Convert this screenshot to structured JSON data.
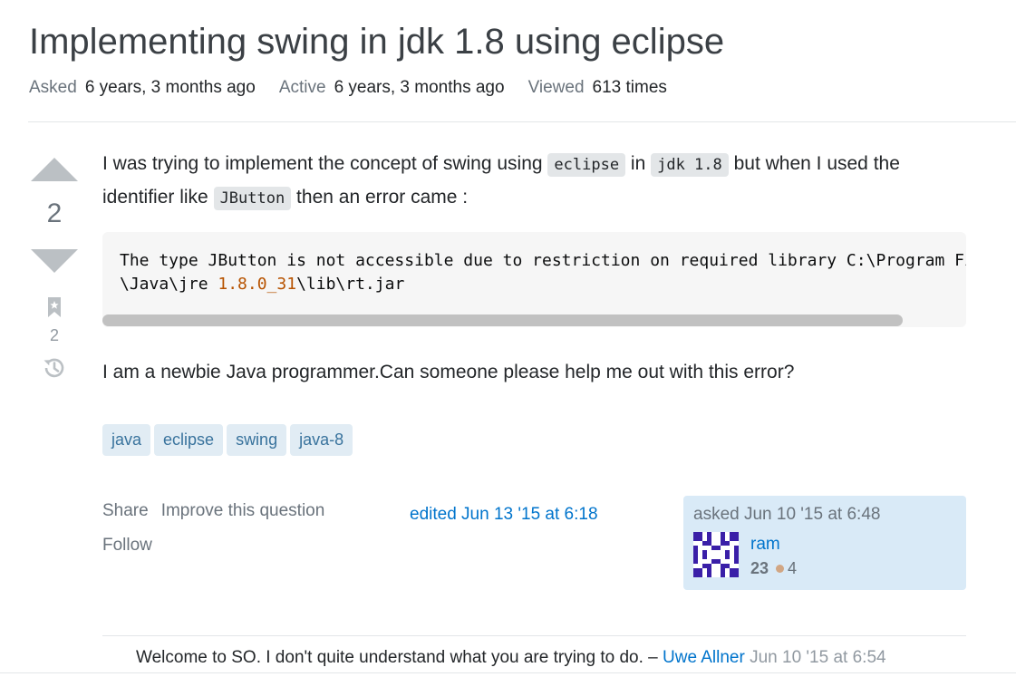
{
  "question": {
    "title": "Implementing swing in jdk 1.8 using eclipse",
    "meta": {
      "asked_label": "Asked",
      "asked_value": "6 years, 3 months ago",
      "active_label": "Active",
      "active_value": "6 years, 3 months ago",
      "viewed_label": "Viewed",
      "viewed_value": "613 times"
    },
    "votes": "2",
    "bookmarks": "2",
    "body": {
      "p1_part1": "I was trying to implement the concept of swing using ",
      "code_eclipse": "eclipse",
      "p1_part2": " in ",
      "code_jdk": "jdk 1.8",
      "p1_part3": " but when I used the identifier like ",
      "code_jbutton": "JButton",
      "p1_part4": " then an error came :",
      "code_line1": "The type JButton is not accessible due to restriction on required library C:\\Program Files",
      "code_line2_prefix": "\\Java\\jre ",
      "code_line2_num": "1.8.0_31",
      "code_line2_suffix": "\\lib\\rt.jar",
      "p2": "I am a newbie Java programmer.Can someone please help me out with this error?"
    },
    "tags": [
      "java",
      "eclipse",
      "swing",
      "java-8"
    ],
    "post_menu": {
      "share": "Share",
      "improve": "Improve this question",
      "follow": "Follow"
    },
    "edited": "edited Jun 13 '15 at 6:18",
    "owner": {
      "asked": "asked Jun 10 '15 at 6:48",
      "name": "ram",
      "reputation": "23",
      "bronze_badges": "4",
      "badge_color": "#d1a684"
    }
  },
  "comments": [
    {
      "text": "Welcome to SO. I don't quite understand what you are trying to do. – ",
      "user": "Uwe Allner",
      "date": "Jun 10 '15 at 6:54"
    }
  ],
  "colors": {
    "link": "#0074cc",
    "tag_bg": "#e1ecf4",
    "tag_text": "#39739d",
    "owner_card_bg": "#d9eaf7"
  }
}
